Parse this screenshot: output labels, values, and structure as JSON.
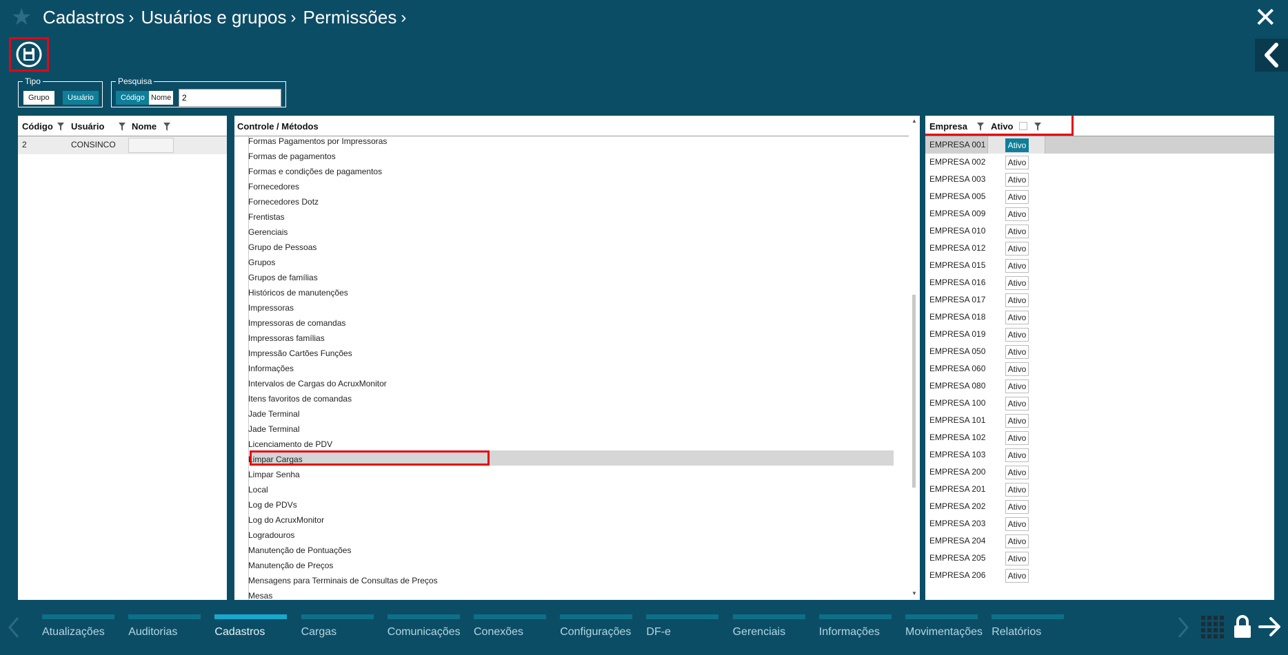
{
  "header": {
    "breadcrumbs": [
      "Cadastros",
      "Usuários e grupos",
      "Permissões"
    ]
  },
  "tipo": {
    "legend": "Tipo",
    "options": [
      "Grupo",
      "Usuário"
    ],
    "selected": "Usuário"
  },
  "pesquisa": {
    "legend": "Pesquisa",
    "options": [
      "Código",
      "Nome"
    ],
    "selected": "Código",
    "value": "2"
  },
  "users_table": {
    "columns": [
      "Código",
      "Usuário",
      "Nome"
    ],
    "rows": [
      {
        "codigo": "2",
        "usuario": "CONSINCO",
        "nome": ""
      }
    ]
  },
  "methods": {
    "header": "Controle / Métodos",
    "items": [
      "Formas Pagamentos por Impressoras",
      "Formas de pagamentos",
      "Formas e condições de pagamentos",
      "Fornecedores",
      "Fornecedores Dotz",
      "Frentistas",
      "Gerenciais",
      "Grupo de Pessoas",
      "Grupos",
      "Grupos de famílias",
      "Históricos de manutenções",
      "Impressoras",
      "Impressoras de comandas",
      "Impressoras famílias",
      "Impressão Cartões Funções",
      "Informações",
      "Intervalos de Cargas do AcruxMonitor",
      "Itens favoritos de comandas",
      "Jade Terminal",
      "Jade Terminal",
      "Licenciamento de PDV",
      "Limpar Cargas",
      "Limpar Senha",
      "Local",
      "Log de PDVs",
      "Log do AcruxMonitor",
      "Logradouros",
      "Manutenção de Pontuações",
      "Manutenção de Preços",
      "Mensagens para Terminais de Consultas de Preços",
      "Mesas"
    ],
    "selected": "Limpar Cargas"
  },
  "empresas": {
    "columns": [
      "Empresa",
      "Ativo"
    ],
    "ativo_label": "Ativo",
    "rows": [
      {
        "empresa": "EMPRESA 001",
        "ativo": "Ativo",
        "selected": true
      },
      {
        "empresa": "EMPRESA 002",
        "ativo": "Ativo"
      },
      {
        "empresa": "EMPRESA 003",
        "ativo": "Ativo"
      },
      {
        "empresa": "EMPRESA 005",
        "ativo": "Ativo"
      },
      {
        "empresa": "EMPRESA 009",
        "ativo": "Ativo"
      },
      {
        "empresa": "EMPRESA 010",
        "ativo": "Ativo"
      },
      {
        "empresa": "EMPRESA 012",
        "ativo": "Ativo"
      },
      {
        "empresa": "EMPRESA 015",
        "ativo": "Ativo"
      },
      {
        "empresa": "EMPRESA 016",
        "ativo": "Ativo"
      },
      {
        "empresa": "EMPRESA 017",
        "ativo": "Ativo"
      },
      {
        "empresa": "EMPRESA 018",
        "ativo": "Ativo"
      },
      {
        "empresa": "EMPRESA 019",
        "ativo": "Ativo"
      },
      {
        "empresa": "EMPRESA 050",
        "ativo": "Ativo"
      },
      {
        "empresa": "EMPRESA 060",
        "ativo": "Ativo"
      },
      {
        "empresa": "EMPRESA 080",
        "ativo": "Ativo"
      },
      {
        "empresa": "EMPRESA 100",
        "ativo": "Ativo"
      },
      {
        "empresa": "EMPRESA 101",
        "ativo": "Ativo"
      },
      {
        "empresa": "EMPRESA 102",
        "ativo": "Ativo"
      },
      {
        "empresa": "EMPRESA 103",
        "ativo": "Ativo"
      },
      {
        "empresa": "EMPRESA 200",
        "ativo": "Ativo"
      },
      {
        "empresa": "EMPRESA 201",
        "ativo": "Ativo"
      },
      {
        "empresa": "EMPRESA 202",
        "ativo": "Ativo"
      },
      {
        "empresa": "EMPRESA 203",
        "ativo": "Ativo"
      },
      {
        "empresa": "EMPRESA 204",
        "ativo": "Ativo"
      },
      {
        "empresa": "EMPRESA 205",
        "ativo": "Ativo"
      },
      {
        "empresa": "EMPRESA 206",
        "ativo": "Ativo"
      }
    ]
  },
  "bottom_nav": {
    "items": [
      "Atualizações",
      "Auditorias",
      "Cadastros",
      "Cargas",
      "Comunicações",
      "Conexões",
      "Configurações",
      "DF-e",
      "Gerenciais",
      "Informações",
      "Movimentações",
      "Relatórios"
    ],
    "active": "Cadastros"
  },
  "colors": {
    "background": "#0c4d66",
    "accent": "#0f7f99",
    "highlight": "#e30613"
  }
}
